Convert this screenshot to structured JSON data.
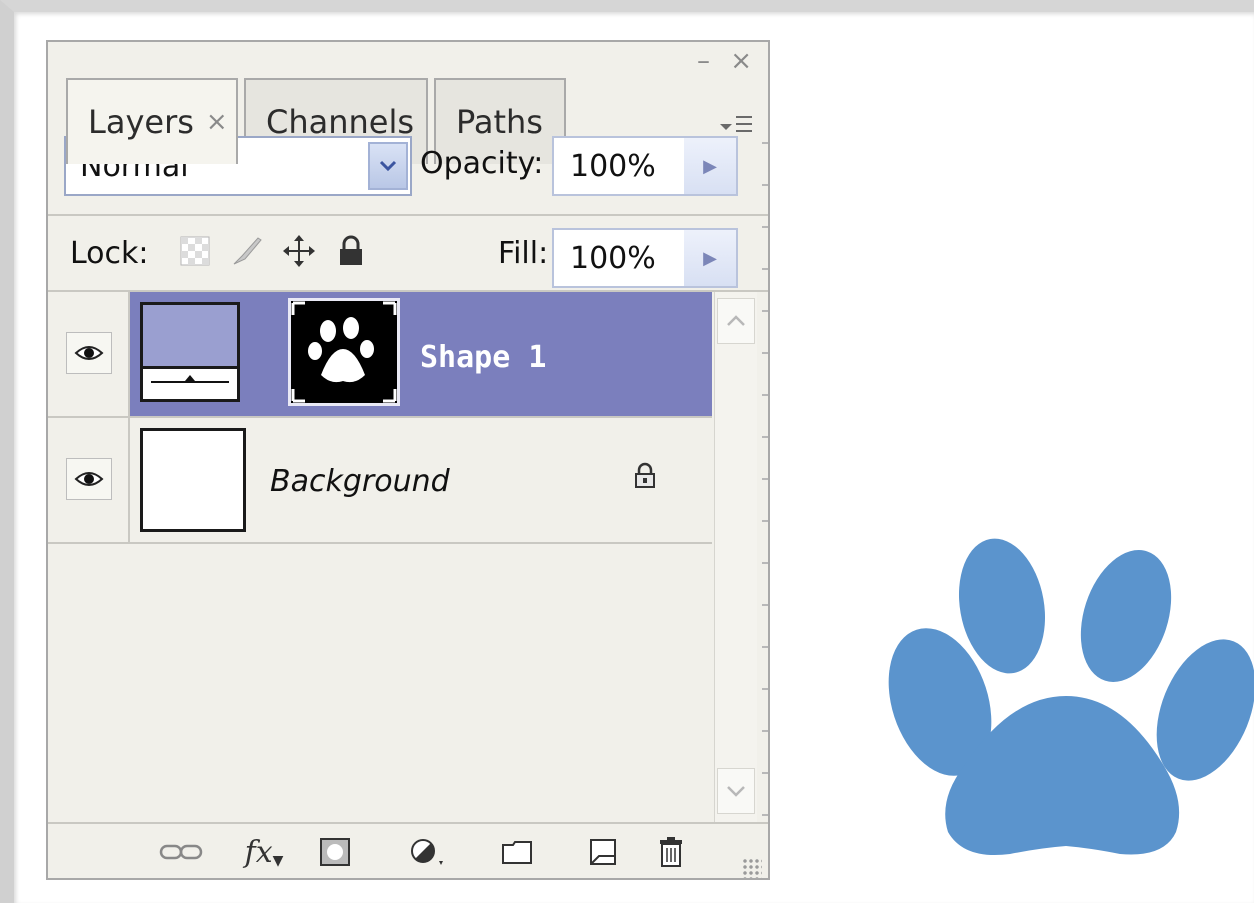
{
  "panel": {
    "window_controls": "– ×",
    "tabs": [
      {
        "label": "Layers",
        "close": "×",
        "active": true
      },
      {
        "label": "Channels",
        "active": false
      },
      {
        "label": "Paths",
        "active": false
      }
    ],
    "menu_icon": "panel-menu-icon",
    "blend_mode": "Normal",
    "opacity_label": "Opacity:",
    "opacity_value": "100%",
    "lock_label": "Lock:",
    "lock_icons": [
      "lock-transparent-pixels-icon",
      "lock-image-pixels-icon",
      "lock-position-icon",
      "lock-all-icon"
    ],
    "fill_label": "Fill:",
    "fill_value": "100%",
    "layers": [
      {
        "name": "Shape 1",
        "selected": true,
        "visible": true,
        "type": "shape"
      },
      {
        "name": "Background",
        "selected": false,
        "visible": true,
        "locked": true,
        "type": "background"
      }
    ],
    "toolbar_icons": [
      "link-layers-icon",
      "layer-style-fx-icon",
      "add-mask-icon",
      "adjustment-layer-icon",
      "new-group-icon",
      "new-layer-icon",
      "delete-layer-icon"
    ],
    "fx_label": "fx"
  },
  "colors": {
    "selected_row": "#7b7fbd",
    "shape_fill": "#9a9fd0",
    "paw_color": "#5b94cd"
  }
}
